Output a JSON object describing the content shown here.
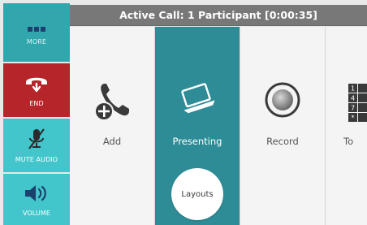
{
  "sidebar": {
    "more_label": "MORE",
    "end_label": "END",
    "mute_label": "MUTE AUDIO",
    "volume_label": "VOLUME"
  },
  "header": {
    "title": "Active Call: 1 Participant [0:00:35]"
  },
  "tiles": {
    "add_label": "Add",
    "presenting_label": "Presenting",
    "record_label": "Record",
    "tones_label": "To",
    "layouts_label": "Layouts",
    "keypad_digits": [
      "1",
      "4",
      "7",
      "*"
    ]
  },
  "colors": {
    "more_bg": "#31a7ad",
    "end_bg": "#b5252a",
    "mute_bg": "#43c6cb",
    "volume_bg": "#43c6cb",
    "presenting_bg": "#2e8c96",
    "titlebar_bg": "#787878"
  },
  "icons": {
    "more": "three-dots-icon",
    "end": "hangup-phone-icon",
    "mute": "microphone-muted-icon",
    "volume": "speaker-icon",
    "add": "add-participant-icon",
    "presenting": "laptop-icon",
    "record": "record-icon",
    "tones": "keypad-icon"
  }
}
